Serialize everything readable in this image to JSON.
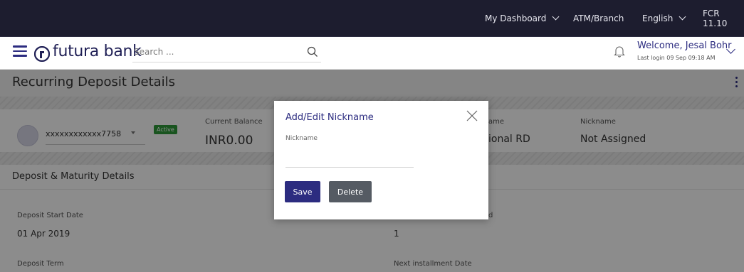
{
  "topnav": {
    "dashboard": "My Dashboard",
    "atm_branch": "ATM/Branch",
    "language": "English",
    "fcr": "FCR 11.10"
  },
  "header": {
    "brand": "futura bank",
    "search_placeholder": "Search ...",
    "welcome": "Welcome, Jesal Bohr",
    "last_login": "Last login 09 Sep 09:18 AM"
  },
  "page": {
    "title": "Recurring Deposit Details",
    "account_number": "xxxxxxxxxxxx7758",
    "status": "Active",
    "current_balance_label": "Current Balance",
    "current_balance_value": "INR0.00",
    "product_name_label_partial": "ame",
    "product_name_value_partial": "ional RD",
    "nickname_label": "Nickname",
    "nickname_value": "Not Assigned",
    "section_title": "Deposit & Maturity Details",
    "deposit_start_label": "Deposit Start Date",
    "deposit_start_value": "01 Apr 2019",
    "middle_label_partial": "d",
    "middle_value": "1",
    "deposit_term_label": "Deposit Term",
    "next_installment_label": "Next installment Date"
  },
  "modal": {
    "title": "Add/Edit Nickname",
    "field_label": "Nickname",
    "field_value": "",
    "save_label": "Save",
    "delete_label": "Delete"
  },
  "colors": {
    "topbar": "#1d1d2f",
    "brand": "#2c2c80",
    "active_badge": "#2e9a3a",
    "delete_button": "#555b63"
  }
}
